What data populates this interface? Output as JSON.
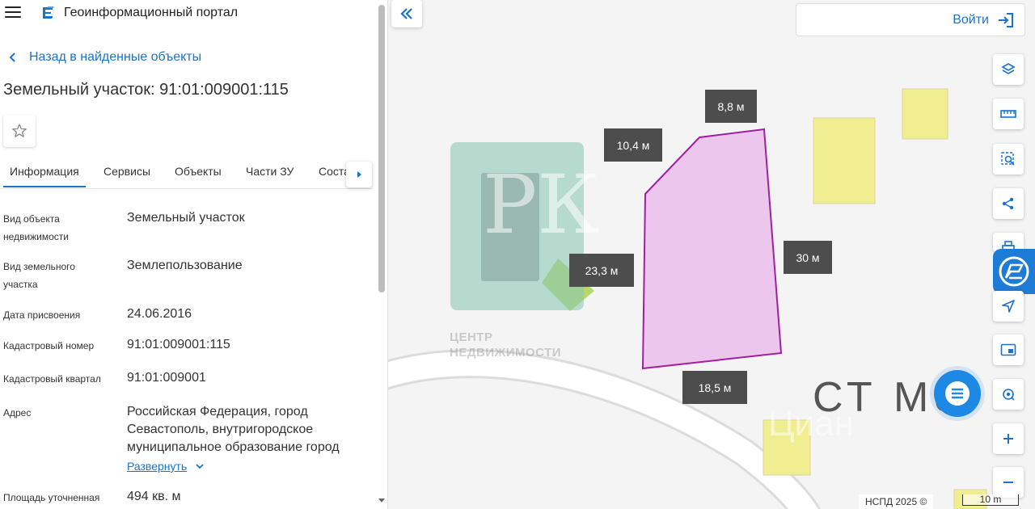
{
  "header": {
    "portal_title": "Геоинформационный портал"
  },
  "nav": {
    "back_label": "Назад в найденные объекты"
  },
  "object": {
    "title": "Земельный участок: 91:01:009001:115"
  },
  "tabs": [
    {
      "label": "Информация",
      "active": true
    },
    {
      "label": "Сервисы"
    },
    {
      "label": "Объекты"
    },
    {
      "label": "Части ЗУ"
    },
    {
      "label": "Соста"
    }
  ],
  "properties": [
    {
      "label": "Вид объекта недвижимости",
      "value": "Земельный участок"
    },
    {
      "label": "Вид земельного участка",
      "value": "Землепользование"
    },
    {
      "label": "Дата присвоения",
      "value": "24.06.2016"
    },
    {
      "label": "Кадастровый номер",
      "value": "91:01:009001:115"
    },
    {
      "label": "Кадастровый квартал",
      "value": "91:01:009001"
    },
    {
      "label": "Адрес",
      "value": "Российская Федерация, город Севастополь, внутригородское муниципальное образование город"
    },
    {
      "label": "Площадь уточненная",
      "value": "494 кв. м"
    }
  ],
  "expand_label": "Развернуть",
  "map": {
    "login_label": "Войти",
    "dimensions": [
      "8,8 м",
      "10,4 м",
      "30 м",
      "23,3 м",
      "18,5 м"
    ],
    "logo_caption_line1": "ЦЕНТР",
    "logo_caption_line2": "НЕДВИЖИМОСТИ",
    "logo_letters": "РК",
    "street_label": "СТ  Ме",
    "watermark": "Циан",
    "attribution": "НСПД 2025 ©",
    "scale_label": "10 m",
    "colors": {
      "parcel_fill": "#ecc6ec",
      "parcel_stroke": "#a020a0",
      "building": "#f0ee90",
      "accent": "#1a73c9"
    }
  }
}
